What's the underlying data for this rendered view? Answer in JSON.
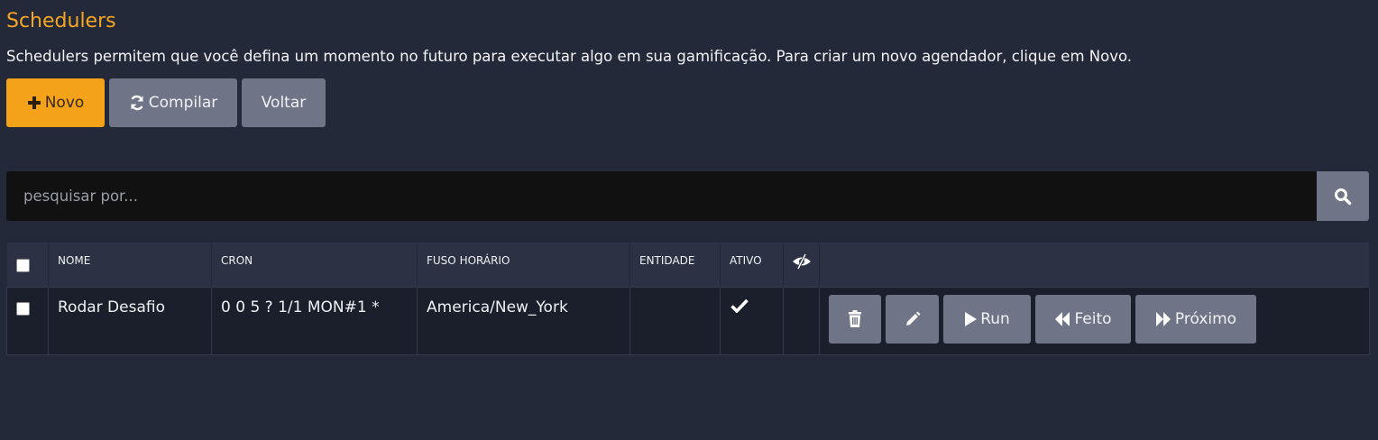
{
  "header": {
    "title": "Schedulers",
    "description": "Schedulers permitem que você defina um momento no futuro para executar algo em sua gamificação. Para criar um novo agendador, clique em Novo."
  },
  "toolbar": {
    "new_label": "Novo",
    "compile_label": "Compilar",
    "back_label": "Voltar"
  },
  "search": {
    "placeholder": "pesquisar por...",
    "value": ""
  },
  "table": {
    "columns": [
      "NOME",
      "CRON",
      "FUSO HORÁRIO",
      "ENTIDADE",
      "ATIVO"
    ],
    "rows": [
      {
        "nome": "Rodar Desafio",
        "cron": "0 0 5 ? 1/1 MON#1 *",
        "fuso": "America/New_York",
        "entidade": "",
        "ativo": true
      }
    ],
    "row_actions": {
      "run_label": "Run",
      "done_label": "Feito",
      "next_label": "Próximo"
    }
  },
  "colors": {
    "background": "#242939",
    "accent": "#f5a21b",
    "button": "#6f7487"
  }
}
